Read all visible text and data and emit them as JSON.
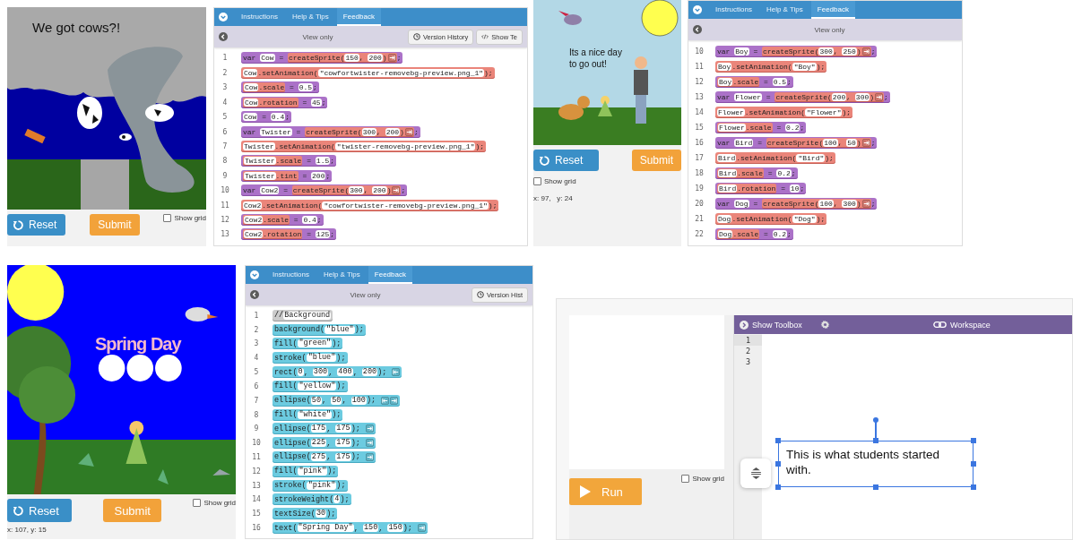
{
  "panels": [
    {
      "kind": "sprite-lab",
      "canvas": {
        "kind": "tornado",
        "caption": "We got cows?!"
      },
      "reset": "Reset",
      "submit": "Submit",
      "show_grid": {
        "label": "Show grid",
        "checked": false
      },
      "tabs": [
        {
          "label": "Instructions",
          "selected": false
        },
        {
          "label": "Help & Tips",
          "selected": false
        },
        {
          "label": "Feedback",
          "selected": true
        }
      ],
      "view_mode": "View only",
      "header_buttons": [
        {
          "kind": "history",
          "label": "Version History"
        },
        {
          "kind": "code",
          "label": "Show Te"
        }
      ],
      "lines": [
        {
          "number": "1",
          "kind": "variable",
          "parts": [
            {
              "kind": "text",
              "text": "var "
            },
            {
              "kind": "field",
              "text": "Cow"
            },
            {
              "kind": "text",
              "text": " = "
            },
            {
              "kind": "sprite-block",
              "parts": [
                {
                  "kind": "text",
                  "text": "createSprite("
                },
                {
                  "kind": "field",
                  "text": "150"
                },
                {
                  "kind": "text",
                  "text": ", "
                },
                {
                  "kind": "field",
                  "text": "200"
                },
                {
                  "kind": "text",
                  "text": ")"
                },
                {
                  "kind": "arrow-right"
                }
              ]
            },
            {
              "kind": "text",
              "text": ";"
            }
          ]
        },
        {
          "number": "2",
          "kind": "sprite",
          "parts": [
            {
              "kind": "field",
              "text": "Cow"
            },
            {
              "kind": "text",
              "text": ".setAnimation("
            },
            {
              "kind": "dropdown",
              "text": "\"cowfortwister-removebg-preview.png_1\""
            },
            {
              "kind": "text",
              "text": ");"
            }
          ]
        },
        {
          "number": "3",
          "kind": "variable",
          "parts": [
            {
              "kind": "sprite-block",
              "parts": [
                {
                  "kind": "field",
                  "text": "Cow"
                },
                {
                  "kind": "text",
                  "text": ".scale"
                }
              ]
            },
            {
              "kind": "text",
              "text": " = "
            },
            {
              "kind": "field",
              "text": "0.5"
            },
            {
              "kind": "text",
              "text": ";"
            }
          ]
        },
        {
          "number": "4",
          "kind": "variable",
          "parts": [
            {
              "kind": "sprite-block",
              "parts": [
                {
                  "kind": "field",
                  "text": "Cow"
                },
                {
                  "kind": "text",
                  "text": ".rotation"
                }
              ]
            },
            {
              "kind": "text",
              "text": " = "
            },
            {
              "kind": "field",
              "text": "45"
            },
            {
              "kind": "text",
              "text": ";"
            }
          ]
        },
        {
          "number": "5",
          "kind": "variable",
          "parts": [
            {
              "kind": "field",
              "text": "Cow"
            },
            {
              "kind": "text",
              "text": " = "
            },
            {
              "kind": "field",
              "text": "0.4"
            },
            {
              "kind": "text",
              "text": ";"
            }
          ]
        },
        {
          "number": "6",
          "kind": "variable",
          "parts": [
            {
              "kind": "text",
              "text": "var "
            },
            {
              "kind": "field",
              "text": "Twister"
            },
            {
              "kind": "text",
              "text": " = "
            },
            {
              "kind": "sprite-block",
              "parts": [
                {
                  "kind": "text",
                  "text": "createSprite("
                },
                {
                  "kind": "field",
                  "text": "300"
                },
                {
                  "kind": "text",
                  "text": ", "
                },
                {
                  "kind": "field",
                  "text": "200"
                },
                {
                  "kind": "text",
                  "text": ")"
                },
                {
                  "kind": "arrow-right"
                }
              ]
            },
            {
              "kind": "text",
              "text": ";"
            }
          ]
        },
        {
          "number": "7",
          "kind": "sprite",
          "parts": [
            {
              "kind": "field",
              "text": "Twister"
            },
            {
              "kind": "text",
              "text": ".setAnimation("
            },
            {
              "kind": "dropdown",
              "text": "\"twister-removebg-preview.png_1\""
            },
            {
              "kind": "text",
              "text": ");"
            }
          ]
        },
        {
          "number": "8",
          "kind": "variable",
          "parts": [
            {
              "kind": "sprite-block",
              "parts": [
                {
                  "kind": "field",
                  "text": "Twister"
                },
                {
                  "kind": "text",
                  "text": ".scale"
                }
              ]
            },
            {
              "kind": "text",
              "text": " = "
            },
            {
              "kind": "field",
              "text": "1.5"
            },
            {
              "kind": "text",
              "text": ";"
            }
          ]
        },
        {
          "number": "9",
          "kind": "variable",
          "parts": [
            {
              "kind": "sprite-block",
              "parts": [
                {
                  "kind": "field",
                  "text": "Twister"
                },
                {
                  "kind": "text",
                  "text": ".tint"
                }
              ]
            },
            {
              "kind": "text",
              "text": " = "
            },
            {
              "kind": "field",
              "text": "200"
            },
            {
              "kind": "text",
              "text": ";"
            }
          ]
        },
        {
          "number": "10",
          "kind": "variable",
          "parts": [
            {
              "kind": "text",
              "text": "var "
            },
            {
              "kind": "field",
              "text": "Cow2"
            },
            {
              "kind": "text",
              "text": " = "
            },
            {
              "kind": "sprite-block",
              "parts": [
                {
                  "kind": "text",
                  "text": "createSprite("
                },
                {
                  "kind": "field",
                  "text": "300"
                },
                {
                  "kind": "text",
                  "text": ", "
                },
                {
                  "kind": "field",
                  "text": "200"
                },
                {
                  "kind": "text",
                  "text": ")"
                },
                {
                  "kind": "arrow-right"
                }
              ]
            },
            {
              "kind": "text",
              "text": ";"
            }
          ]
        },
        {
          "number": "11",
          "kind": "sprite",
          "parts": [
            {
              "kind": "field",
              "text": "Cow2"
            },
            {
              "kind": "text",
              "text": ".setAnimation("
            },
            {
              "kind": "dropdown",
              "text": "\"cowfortwister-removebg-preview.png_1\""
            },
            {
              "kind": "text",
              "text": ");"
            }
          ]
        },
        {
          "number": "12",
          "kind": "variable",
          "parts": [
            {
              "kind": "sprite-block",
              "parts": [
                {
                  "kind": "field",
                  "text": "Cow2"
                },
                {
                  "kind": "text",
                  "text": ".scale"
                }
              ]
            },
            {
              "kind": "text",
              "text": " = "
            },
            {
              "kind": "field",
              "text": "0.4"
            },
            {
              "kind": "text",
              "text": ";"
            }
          ]
        },
        {
          "number": "13",
          "kind": "variable",
          "parts": [
            {
              "kind": "sprite-block",
              "parts": [
                {
                  "kind": "field",
                  "text": "Cow2"
                },
                {
                  "kind": "text",
                  "text": ".rotation"
                }
              ]
            },
            {
              "kind": "text",
              "text": " = "
            },
            {
              "kind": "field",
              "text": "125"
            },
            {
              "kind": "text",
              "text": ";"
            }
          ]
        }
      ]
    },
    {
      "kind": "sprite-lab",
      "canvas": {
        "kind": "park",
        "caption": "Its a nice day to go out!"
      },
      "reset": "Reset",
      "submit": "Submit",
      "show_grid": {
        "label": "Show grid",
        "checked": false
      },
      "coordinates": "x: 97,   y: 24",
      "tabs": [
        {
          "label": "Instructions",
          "selected": false
        },
        {
          "label": "Help & Tips",
          "selected": false
        },
        {
          "label": "Feedback",
          "selected": true
        }
      ],
      "view_mode": "View only",
      "lines": [
        {
          "number": "10",
          "kind": "variable",
          "parts": [
            {
              "kind": "text",
              "text": "var "
            },
            {
              "kind": "field",
              "text": "Boy"
            },
            {
              "kind": "text",
              "text": " = "
            },
            {
              "kind": "sprite-block",
              "parts": [
                {
                  "kind": "text",
                  "text": "createSprite("
                },
                {
                  "kind": "field",
                  "text": "300"
                },
                {
                  "kind": "text",
                  "text": ", "
                },
                {
                  "kind": "field",
                  "text": "250"
                },
                {
                  "kind": "text",
                  "text": ")"
                },
                {
                  "kind": "arrow-right"
                }
              ]
            },
            {
              "kind": "text",
              "text": ";"
            }
          ]
        },
        {
          "number": "11",
          "kind": "sprite",
          "parts": [
            {
              "kind": "field",
              "text": "Boy"
            },
            {
              "kind": "text",
              "text": ".setAnimation("
            },
            {
              "kind": "dropdown",
              "text": "\"Boy\""
            },
            {
              "kind": "text",
              "text": ");"
            }
          ]
        },
        {
          "number": "12",
          "kind": "variable",
          "parts": [
            {
              "kind": "sprite-block",
              "parts": [
                {
                  "kind": "field",
                  "text": "Boy"
                },
                {
                  "kind": "text",
                  "text": ".scale"
                }
              ]
            },
            {
              "kind": "text",
              "text": " = "
            },
            {
              "kind": "field",
              "text": "0.5"
            },
            {
              "kind": "text",
              "text": ";"
            }
          ]
        },
        {
          "number": "13",
          "kind": "variable",
          "parts": [
            {
              "kind": "text",
              "text": "var "
            },
            {
              "kind": "field",
              "text": "Flower"
            },
            {
              "kind": "text",
              "text": " = "
            },
            {
              "kind": "sprite-block",
              "parts": [
                {
                  "kind": "text",
                  "text": "createSprite("
                },
                {
                  "kind": "field",
                  "text": "200"
                },
                {
                  "kind": "text",
                  "text": ", "
                },
                {
                  "kind": "field",
                  "text": "300"
                },
                {
                  "kind": "text",
                  "text": ")"
                },
                {
                  "kind": "arrow-right"
                }
              ]
            },
            {
              "kind": "text",
              "text": ";"
            }
          ]
        },
        {
          "number": "14",
          "kind": "sprite",
          "parts": [
            {
              "kind": "field",
              "text": "Flower"
            },
            {
              "kind": "text",
              "text": ".setAnimation("
            },
            {
              "kind": "dropdown",
              "text": "\"Flower\""
            },
            {
              "kind": "text",
              "text": ");"
            }
          ]
        },
        {
          "number": "15",
          "kind": "variable",
          "parts": [
            {
              "kind": "sprite-block",
              "parts": [
                {
                  "kind": "field",
                  "text": "Flower"
                },
                {
                  "kind": "text",
                  "text": ".scale"
                }
              ]
            },
            {
              "kind": "text",
              "text": " = "
            },
            {
              "kind": "field",
              "text": "0.2"
            },
            {
              "kind": "text",
              "text": ";"
            }
          ]
        },
        {
          "number": "16",
          "kind": "variable",
          "parts": [
            {
              "kind": "text",
              "text": "var "
            },
            {
              "kind": "field",
              "text": "Bird"
            },
            {
              "kind": "text",
              "text": " = "
            },
            {
              "kind": "sprite-block",
              "parts": [
                {
                  "kind": "text",
                  "text": "createSprite("
                },
                {
                  "kind": "field",
                  "text": "100"
                },
                {
                  "kind": "text",
                  "text": ", "
                },
                {
                  "kind": "field",
                  "text": "50"
                },
                {
                  "kind": "text",
                  "text": ")"
                },
                {
                  "kind": "arrow-right"
                }
              ]
            },
            {
              "kind": "text",
              "text": ";"
            }
          ]
        },
        {
          "number": "17",
          "kind": "sprite",
          "parts": [
            {
              "kind": "field",
              "text": "Bird"
            },
            {
              "kind": "text",
              "text": ".setAnimation("
            },
            {
              "kind": "dropdown",
              "text": "\"Bird\""
            },
            {
              "kind": "text",
              "text": ");"
            }
          ]
        },
        {
          "number": "18",
          "kind": "variable",
          "parts": [
            {
              "kind": "sprite-block",
              "parts": [
                {
                  "kind": "field",
                  "text": "Bird"
                },
                {
                  "kind": "text",
                  "text": ".scale"
                }
              ]
            },
            {
              "kind": "text",
              "text": " = "
            },
            {
              "kind": "field",
              "text": "0.2"
            },
            {
              "kind": "text",
              "text": ";"
            }
          ]
        },
        {
          "number": "19",
          "kind": "variable",
          "parts": [
            {
              "kind": "sprite-block",
              "parts": [
                {
                  "kind": "field",
                  "text": "Bird"
                },
                {
                  "kind": "text",
                  "text": ".rotation"
                }
              ]
            },
            {
              "kind": "text",
              "text": " = "
            },
            {
              "kind": "field",
              "text": "10"
            },
            {
              "kind": "text",
              "text": ";"
            }
          ]
        },
        {
          "number": "20",
          "kind": "variable",
          "parts": [
            {
              "kind": "text",
              "text": "var "
            },
            {
              "kind": "field",
              "text": "Dog"
            },
            {
              "kind": "text",
              "text": " = "
            },
            {
              "kind": "sprite-block",
              "parts": [
                {
                  "kind": "text",
                  "text": "createSprite("
                },
                {
                  "kind": "field",
                  "text": "100"
                },
                {
                  "kind": "text",
                  "text": ", "
                },
                {
                  "kind": "field",
                  "text": "300"
                },
                {
                  "kind": "text",
                  "text": ")"
                },
                {
                  "kind": "arrow-right"
                }
              ]
            },
            {
              "kind": "text",
              "text": ";"
            }
          ]
        },
        {
          "number": "21",
          "kind": "sprite",
          "parts": [
            {
              "kind": "field",
              "text": "Dog"
            },
            {
              "kind": "text",
              "text": ".setAnimation("
            },
            {
              "kind": "dropdown",
              "text": "\"Dog\""
            },
            {
              "kind": "text",
              "text": ");"
            }
          ]
        },
        {
          "number": "22",
          "kind": "variable",
          "parts": [
            {
              "kind": "sprite-block",
              "parts": [
                {
                  "kind": "field",
                  "text": "Dog"
                },
                {
                  "kind": "text",
                  "text": ".scale"
                }
              ]
            },
            {
              "kind": "text",
              "text": " = "
            },
            {
              "kind": "field",
              "text": "0.2"
            },
            {
              "kind": "text",
              "text": ";"
            }
          ]
        }
      ]
    },
    {
      "kind": "sprite-lab",
      "canvas": {
        "kind": "spring",
        "caption": "Spring Day"
      },
      "reset": "Reset",
      "submit": "Submit",
      "show_grid": {
        "label": "Show grid",
        "checked": false
      },
      "coordinates": "x: 107, y: 15",
      "tabs": [
        {
          "label": "Instructions",
          "selected": false
        },
        {
          "label": "Help & Tips",
          "selected": false
        },
        {
          "label": "Feedback",
          "selected": true
        }
      ],
      "view_mode": "View only",
      "header_buttons": [
        {
          "kind": "history",
          "label": "Version Hist"
        }
      ],
      "lines": [
        {
          "number": "1",
          "kind": "comment",
          "parts": [
            {
              "kind": "text",
              "text": "//"
            },
            {
              "kind": "field",
              "text": "Background"
            }
          ]
        },
        {
          "number": "2",
          "kind": "drawing",
          "parts": [
            {
              "kind": "text",
              "text": "background("
            },
            {
              "kind": "dropdown",
              "text": "\"blue\""
            },
            {
              "kind": "text",
              "text": ");"
            }
          ]
        },
        {
          "number": "3",
          "kind": "drawing",
          "parts": [
            {
              "kind": "text",
              "text": "fill("
            },
            {
              "kind": "dropdown",
              "text": "\"green\""
            },
            {
              "kind": "text",
              "text": ");"
            }
          ]
        },
        {
          "number": "4",
          "kind": "drawing",
          "parts": [
            {
              "kind": "text",
              "text": "stroke("
            },
            {
              "kind": "dropdown",
              "text": "\"blue\""
            },
            {
              "kind": "text",
              "text": ");"
            }
          ]
        },
        {
          "number": "5",
          "kind": "drawing",
          "parts": [
            {
              "kind": "text",
              "text": "rect("
            },
            {
              "kind": "field",
              "text": "0"
            },
            {
              "kind": "text",
              "text": ", "
            },
            {
              "kind": "field",
              "text": "300"
            },
            {
              "kind": "text",
              "text": ", "
            },
            {
              "kind": "field",
              "text": "400"
            },
            {
              "kind": "text",
              "text": ", "
            },
            {
              "kind": "field",
              "text": "200"
            },
            {
              "kind": "text",
              "text": "); "
            },
            {
              "kind": "arrow-left"
            }
          ]
        },
        {
          "number": "6",
          "kind": "drawing",
          "parts": [
            {
              "kind": "text",
              "text": "fill("
            },
            {
              "kind": "dropdown",
              "text": "\"yellow\""
            },
            {
              "kind": "text",
              "text": ");"
            }
          ]
        },
        {
          "number": "7",
          "kind": "drawing",
          "parts": [
            {
              "kind": "text",
              "text": "ellipse("
            },
            {
              "kind": "field",
              "text": "50"
            },
            {
              "kind": "text",
              "text": ", "
            },
            {
              "kind": "field",
              "text": "50"
            },
            {
              "kind": "text",
              "text": ", "
            },
            {
              "kind": "field",
              "text": "100"
            },
            {
              "kind": "text",
              "text": "); "
            },
            {
              "kind": "arrow-left"
            },
            {
              "kind": "arrow-right"
            }
          ]
        },
        {
          "number": "8",
          "kind": "drawing",
          "parts": [
            {
              "kind": "text",
              "text": "fill("
            },
            {
              "kind": "dropdown",
              "text": "\"white\""
            },
            {
              "kind": "text",
              "text": ");"
            }
          ]
        },
        {
          "number": "9",
          "kind": "drawing",
          "parts": [
            {
              "kind": "text",
              "text": "ellipse("
            },
            {
              "kind": "field",
              "text": "175"
            },
            {
              "kind": "text",
              "text": ", "
            },
            {
              "kind": "field",
              "text": "175"
            },
            {
              "kind": "text",
              "text": "); "
            },
            {
              "kind": "arrow-right"
            }
          ]
        },
        {
          "number": "10",
          "kind": "drawing",
          "parts": [
            {
              "kind": "text",
              "text": "ellipse("
            },
            {
              "kind": "field",
              "text": "225"
            },
            {
              "kind": "text",
              "text": ", "
            },
            {
              "kind": "field",
              "text": "175"
            },
            {
              "kind": "text",
              "text": "); "
            },
            {
              "kind": "arrow-right"
            }
          ]
        },
        {
          "number": "11",
          "kind": "drawing",
          "parts": [
            {
              "kind": "text",
              "text": "ellipse("
            },
            {
              "kind": "field",
              "text": "275"
            },
            {
              "kind": "text",
              "text": ", "
            },
            {
              "kind": "field",
              "text": "175"
            },
            {
              "kind": "text",
              "text": "); "
            },
            {
              "kind": "arrow-right"
            }
          ]
        },
        {
          "number": "12",
          "kind": "drawing",
          "parts": [
            {
              "kind": "text",
              "text": "fill("
            },
            {
              "kind": "dropdown",
              "text": "\"pink\""
            },
            {
              "kind": "text",
              "text": ");"
            }
          ]
        },
        {
          "number": "13",
          "kind": "drawing",
          "parts": [
            {
              "kind": "text",
              "text": "stroke("
            },
            {
              "kind": "dropdown",
              "text": "\"pink\""
            },
            {
              "kind": "text",
              "text": ");"
            }
          ]
        },
        {
          "number": "14",
          "kind": "drawing",
          "parts": [
            {
              "kind": "text",
              "text": "strokeWeight("
            },
            {
              "kind": "field",
              "text": "4"
            },
            {
              "kind": "text",
              "text": ");"
            }
          ]
        },
        {
          "number": "15",
          "kind": "drawing",
          "parts": [
            {
              "kind": "text",
              "text": "textSize("
            },
            {
              "kind": "field",
              "text": "30"
            },
            {
              "kind": "text",
              "text": ");"
            }
          ]
        },
        {
          "number": "16",
          "kind": "drawing",
          "parts": [
            {
              "kind": "text",
              "text": "text("
            },
            {
              "kind": "field",
              "text": "\"Spring Day\""
            },
            {
              "kind": "text",
              "text": ", "
            },
            {
              "kind": "field",
              "text": "150"
            },
            {
              "kind": "text",
              "text": ", "
            },
            {
              "kind": "field",
              "text": "150"
            },
            {
              "kind": "text",
              "text": "); "
            },
            {
              "kind": "arrow-right"
            }
          ]
        }
      ]
    },
    {
      "kind": "editor",
      "run": "Run",
      "show_grid": {
        "label": "Show grid",
        "checked": false
      },
      "toolbox": "Show Toolbox",
      "workspace": "Workspace",
      "line_numbers": [
        "1",
        "2",
        "3"
      ],
      "note": "This is what students started with."
    }
  ]
}
